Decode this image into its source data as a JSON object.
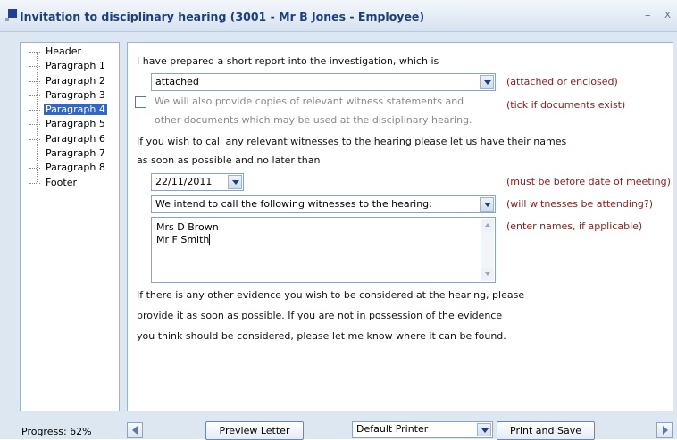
{
  "window": {
    "title": "Invitation to disciplinary hearing (3001 - Mr B Jones - Employee)",
    "minimize": "–",
    "close": "x"
  },
  "tree": {
    "items": [
      "Header",
      "Paragraph 1",
      "Paragraph 2",
      "Paragraph 3",
      "Paragraph 4",
      "Paragraph 5",
      "Paragraph 6",
      "Paragraph 7",
      "Paragraph 8",
      "Footer"
    ],
    "selected_index": 4
  },
  "content": {
    "intro": "I have prepared a short report into the investigation, which is",
    "report_select": {
      "value": "attached"
    },
    "report_hint": "(attached or enclosed)",
    "witness_docs": {
      "checked": false,
      "line1": "We will also provide copies of relevant witness statements and",
      "line2": "other documents which may be used at the disciplinary hearing."
    },
    "witness_docs_hint": "(tick if documents exist)",
    "call_witness_line1": "If you wish to call any relevant witnesses to the hearing please let us have their names",
    "call_witness_line2": "as soon as possible and no later than",
    "date_select": {
      "value": "22/11/2011"
    },
    "date_hint": "(must be before date of meeting)",
    "witness_select": {
      "value": "We intend to call the following witnesses to the hearing:"
    },
    "witness_select_hint": "(will witnesses be attending?)",
    "witness_names": {
      "line1": "Mrs D Brown",
      "line2": "Mr F Smith"
    },
    "witness_names_hint": "(enter names, if applicable)",
    "evidence_line1": "If there is any other evidence you wish to be considered at the hearing, please",
    "evidence_line2": "provide it as soon as possible.  If you are not in possession of the evidence",
    "evidence_line3": "you think should be considered, please let me know where it can be found."
  },
  "footer": {
    "progress_label": "Progress: 62%",
    "preview_button": "Preview Letter",
    "printer_select": {
      "value": "Default Printer"
    },
    "print_save_button": "Print and Save"
  }
}
